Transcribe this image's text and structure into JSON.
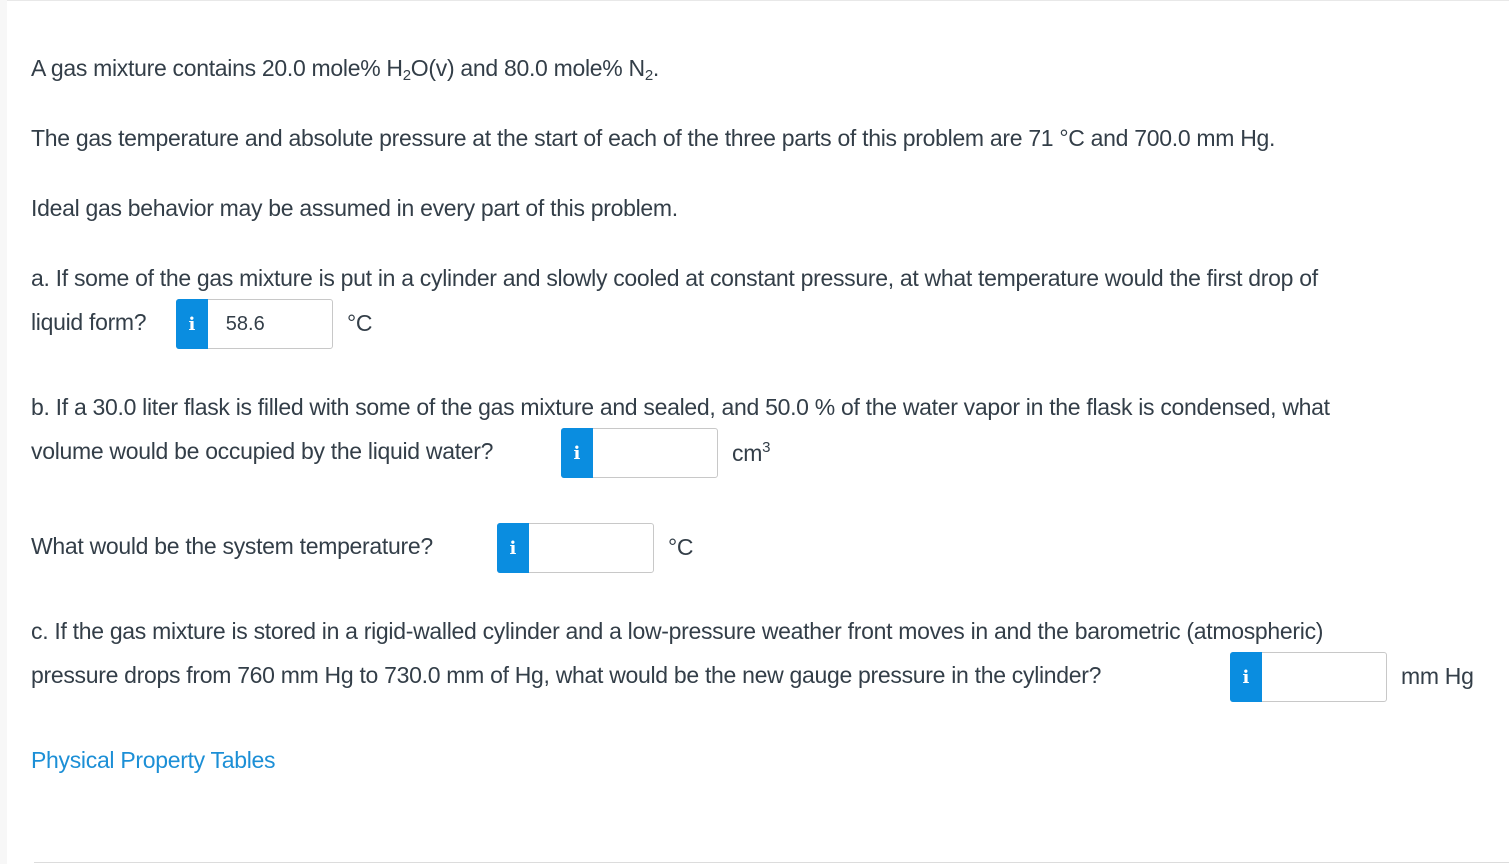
{
  "intro": {
    "composition_prefix": "A gas mixture contains 20.0 mole% H",
    "composition_sub1": "2",
    "composition_mid": "O(v) and 80.0 mole% N",
    "composition_sub2": "2",
    "composition_suffix": ".",
    "conditions": "The gas temperature and absolute pressure at the start of each of the three parts of this problem are 71 °C and 700.0 mm Hg.",
    "assumption": "Ideal gas behavior may be assumed in every part of this problem."
  },
  "part_a": {
    "line1": "a. If some of the gas mixture is put in a cylinder and slowly cooled at constant pressure, at what temperature would the first drop of",
    "line2": "liquid form?",
    "answer_value": "58.6",
    "unit": "°C"
  },
  "part_b": {
    "line1": "b. If a 30.0 liter flask is filled with some of the gas mixture and sealed, and 50.0 % of the water vapor in the flask is condensed, what",
    "line2": "volume would be occupied by the liquid water?",
    "answer_value": "",
    "unit_base": "cm",
    "unit_sup": "3",
    "temp_question": "What would be the system temperature?",
    "temp_answer_value": "",
    "temp_unit": "°C"
  },
  "part_c": {
    "line1": "c. If the gas mixture is stored in a rigid-walled cylinder and a low-pressure weather front moves in and the barometric (atmospheric)",
    "line2": "pressure drops from 760 mm Hg to 730.0 mm of Hg, what would be the new gauge pressure in the cylinder?",
    "answer_value": "",
    "unit": "mm Hg"
  },
  "info_glyph": "i",
  "link": {
    "label": "Physical Property Tables"
  }
}
